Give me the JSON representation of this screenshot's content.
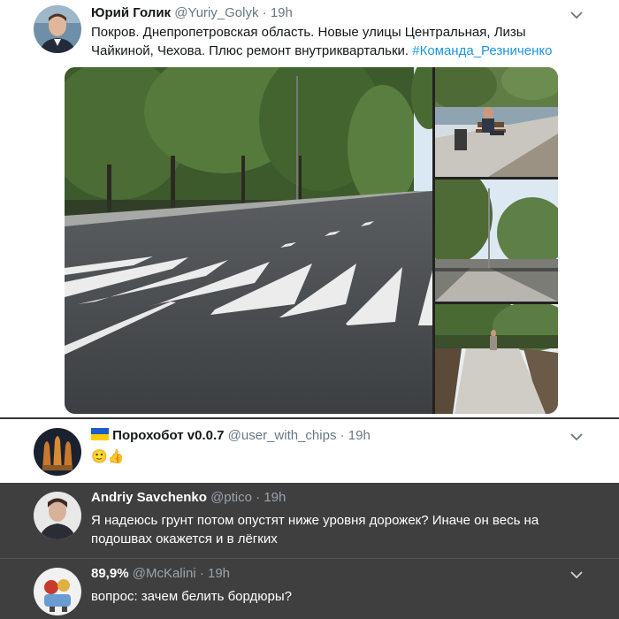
{
  "tweets": [
    {
      "author": "Юрий Голик",
      "handle": "@Yuriy_Golyk",
      "separator": "·",
      "time": "19h",
      "text_line1": "Покров. Днепропетровская область. Новые улицы Центральная, Лизы",
      "text_line2_prefix": "Чайкиной, Чехова. Плюс ремонт внутриквартальки. ",
      "hashtag": "#Команда_Резниченко"
    },
    {
      "flag_icon": "ukraine-flag-icon",
      "author": "Порохобот v0.0.7",
      "handle": "@user_with_chips",
      "separator": "·",
      "time": "19h",
      "emoji": "🙂👍"
    },
    {
      "author": "Andriy Savchenko",
      "handle": "@ptico",
      "separator": "·",
      "time": "19h",
      "text_line1": "Я надеюсь грунт потом опустят ниже уровня дорожек? Иначе он весь на",
      "text_line2": "подошвах окажется и в лёгких"
    },
    {
      "author": "89,9%",
      "handle": "@McKalini",
      "separator": "·",
      "time": "19h",
      "text_line1": "вопрос: зачем белить бордюры?"
    }
  ],
  "colors": {
    "hashtag": "#1b95e0",
    "dark_background": "#3f3f3f",
    "light_background": "#ffffff"
  }
}
